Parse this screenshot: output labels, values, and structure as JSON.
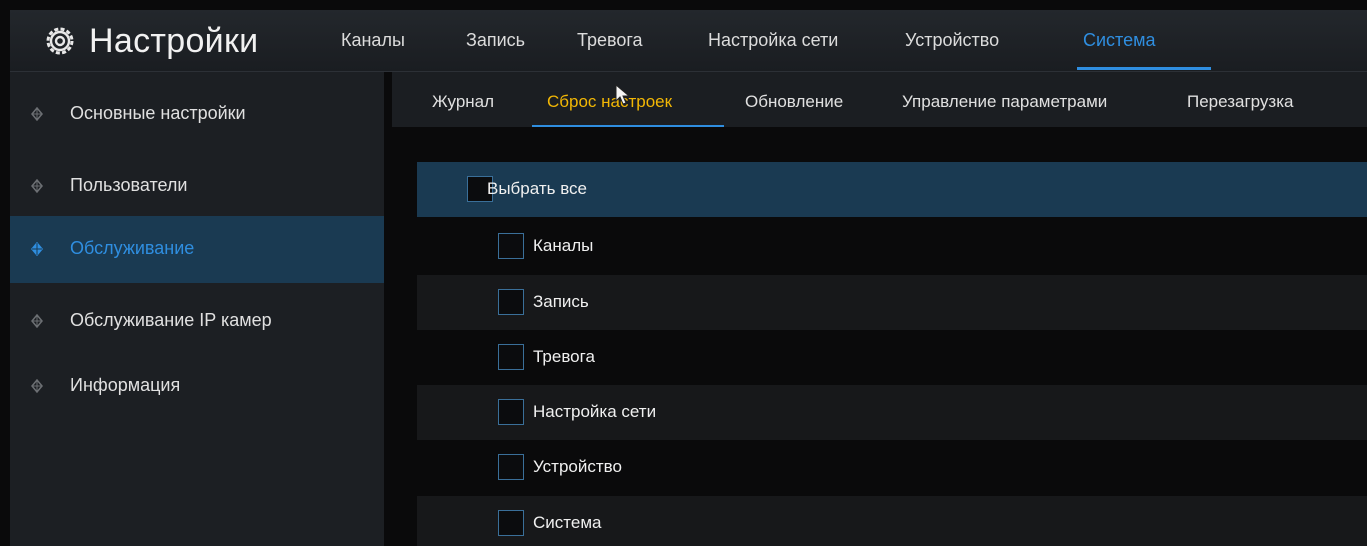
{
  "header": {
    "title": "Настройки",
    "tabs": [
      "Каналы",
      "Запись",
      "Тревога",
      "Настройка сети",
      "Устройство",
      "Система"
    ],
    "active_tab": "Система"
  },
  "sidebar": {
    "items": [
      {
        "label": "Основные настройки"
      },
      {
        "label": "Пользователи"
      },
      {
        "label": "Обслуживание"
      },
      {
        "label": "Обслуживание IP камер"
      },
      {
        "label": "Информация"
      }
    ],
    "active_item": "Обслуживание"
  },
  "subtabs": {
    "items": [
      "Журнал",
      "Сброс настроек",
      "Обновление",
      "Управление параметрами",
      "Перезагрузка"
    ],
    "active": "Сброс настроек"
  },
  "reset": {
    "select_all": "Выбрать все",
    "options": [
      "Каналы",
      "Запись",
      "Тревога",
      "Настройка сети",
      "Устройство",
      "Система"
    ]
  },
  "colors": {
    "accent": "#2f8ee0",
    "active_subtab": "#f2b705",
    "highlight_row": "#1a3a52"
  },
  "icons": {
    "settings": "gear-icon",
    "sidebar_bullet": "diamond-icon",
    "pointer": "cursor-icon"
  }
}
